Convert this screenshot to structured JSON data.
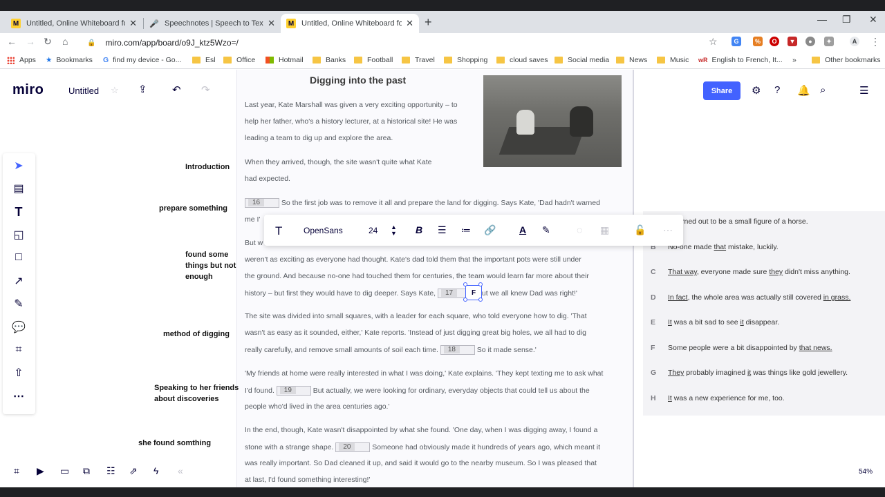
{
  "browser": {
    "tabs": [
      {
        "title": "Untitled, Online Whiteboard for V",
        "icon": "miro-favicon"
      },
      {
        "title": "Speechnotes | Speech to Text Onl",
        "icon": "microphone-favicon"
      },
      {
        "title": "Untitled, Online Whiteboard for V",
        "icon": "miro-favicon",
        "active": true
      }
    ],
    "url": "miro.com/app/board/o9J_ktz5Wzo=/",
    "bookmarks": [
      "Apps",
      "Bookmarks",
      "find my device - Go...",
      "Esl",
      "Office",
      "Hotmail",
      "Banks",
      "Football",
      "Travel",
      "Shopping",
      "cloud saves",
      "Social media",
      "News",
      "Music",
      "English to French, It...",
      "Other bookmarks"
    ],
    "more_bookmarks": "»"
  },
  "miro": {
    "logo": "miro",
    "board_name": "Untitled",
    "share_label": "Share",
    "zoom": "54%",
    "accent": "#4262ff"
  },
  "format_toolbar": {
    "font": "OpenSans",
    "size": "24",
    "selected_value": "F"
  },
  "document": {
    "title": "Digging into the past",
    "lines": [
      "Last year, Kate Marshall was given a very exciting opportunity – to",
      "help her father, who's a history lecturer, at a historical site! He was",
      "leading a team to dig up and explore the area.",
      "When they arrived, though, the site wasn't quite what Kate",
      "had expected.",
      "So the first job was to remove it all and prepare the land for digging. Says Kate, 'Dad hadn't warned",
      "me I'",
      "But w",
      "weren't as exciting as everyone had thought.  Kate's dad told them that the important pots were still under",
      "the ground. And because no-one had touched them for centuries, the team would learn far more about their",
      "history – but first they would have to dig deeper.  Says Kate,",
      "But we all knew Dad was right!'",
      "The site was divided into small squares, with a leader for each square, who told everyone how to dig. 'That",
      "wasn't as easy as it sounded, either,' Kate reports. 'Instead of just digging great big holes, we all had to dig",
      "really carefully, and remove small amounts of soil each time.",
      "So it made sense.'",
      "'My friends at home were really interested in what I was doing,' Kate explains. 'They kept texting me to ask what",
      "I'd found.",
      "But actually, we were looking for ordinary, everyday objects that could tell us about the",
      "people who'd lived in the area centuries ago.'",
      "In the end, though, Kate wasn't disappointed by what she found. 'One day, when I was digging away, I found a",
      "stone with a strange shape.",
      "Someone had obviously made it hundreds of years ago, which meant it",
      "was really important. So Dad cleaned it up, and said it would go to the nearby museum. So I was pleased that",
      "at last, I'd found something interesting!'"
    ],
    "gaps": [
      "16",
      "17",
      "18",
      "19",
      "20"
    ]
  },
  "labels": [
    "Introduction",
    "prepare something",
    "found some things but not enough",
    "method of digging",
    "Speaking to her friends about discoveries",
    "she found somthing"
  ],
  "options": [
    {
      "letter": "",
      "text": "rned out to be a small figure of a horse."
    },
    {
      "letter": "B",
      "text": "No-one made that mistake, luckily."
    },
    {
      "letter": "C",
      "text": "That way, everyone made sure they didn't miss anything."
    },
    {
      "letter": "D",
      "text": "In fact, the whole area was actually still covered in grass."
    },
    {
      "letter": "E",
      "text": "It was a bit sad to see it disappear."
    },
    {
      "letter": "F",
      "text": "Some people were a bit disappointed by that news."
    },
    {
      "letter": "G",
      "text": "They probably imagined it was things like gold jewellery."
    },
    {
      "letter": "H",
      "text": "It was a new experience for me, too."
    }
  ]
}
